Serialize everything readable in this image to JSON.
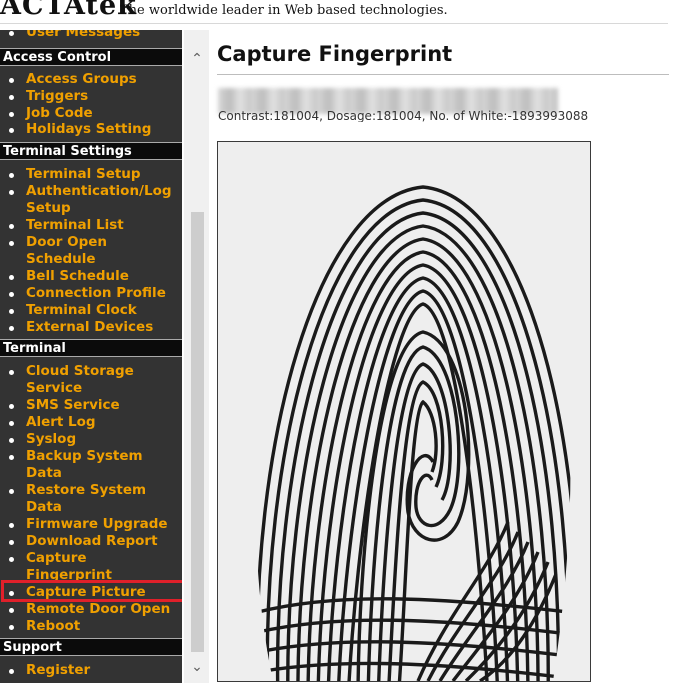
{
  "header": {
    "logo": "ACTAtek",
    "tagline": "The worldwide leader in Web based technologies."
  },
  "sidebar": {
    "top_partial_item": "User Messages",
    "sections": [
      {
        "title": "Access Control",
        "items": [
          "Access Groups",
          "Triggers",
          "Job Code",
          "Holidays Setting"
        ]
      },
      {
        "title": "Terminal Settings",
        "items": [
          "Terminal Setup",
          "Authentication/Log Setup",
          "Terminal List",
          "Door Open Schedule",
          "Bell Schedule",
          "Connection Profile",
          "Terminal Clock",
          "External Devices"
        ]
      },
      {
        "title": "Terminal",
        "items": [
          "Cloud Storage Service",
          "SMS Service",
          "Alert Log",
          "Syslog",
          "Backup System Data",
          "Restore System Data",
          "Firmware Upgrade",
          "Download Report",
          "Capture Fingerprint",
          "Capture Picture",
          "Remote Door Open",
          "Reboot"
        ]
      },
      {
        "title": "Support",
        "items": [
          "Register"
        ]
      }
    ],
    "highlighted_item": "Capture Picture",
    "highlight_color": "#e0202a",
    "link_color": "#f0a000"
  },
  "main": {
    "title": "Capture Fingerprint",
    "info": "Contrast:181004, Dosage:181004, No. of White:-1893993088",
    "image_alt": "fingerprint-image"
  }
}
